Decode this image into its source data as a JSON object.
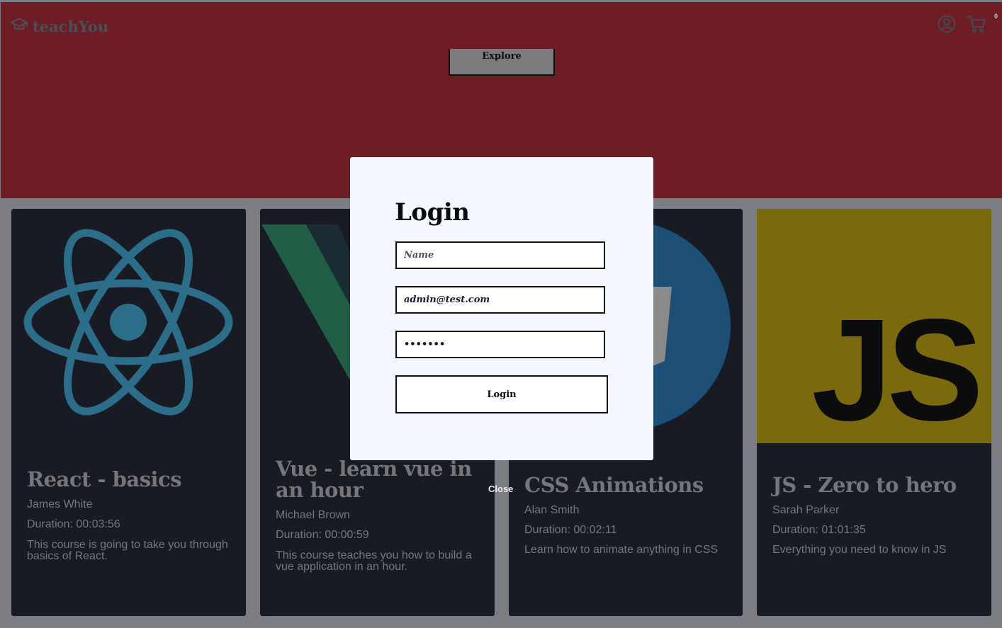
{
  "header": {
    "logo_text": "teachYou",
    "logo_icon": "graduation-cap-icon",
    "user_icon": "user-circle-icon",
    "cart_icon": "cart-icon",
    "cart_count": "0",
    "explore_label": "Explore",
    "hero_color": "#6e1d25"
  },
  "courses": [
    {
      "title": "React - basics",
      "author": "James White",
      "duration": "Duration: 00:03:56",
      "description": "This course is going to take you through basics of React.",
      "image_icon": "react-logo-icon"
    },
    {
      "title": "Vue - learn vue in an hour",
      "author": "Michael Brown",
      "duration": "Duration: 00:00:59",
      "description": "This course teaches you how to build a vue application in an hour.",
      "image_icon": "vue-logo-icon"
    },
    {
      "title": "CSS Animations",
      "author": "Alan Smith",
      "duration": "Duration: 00:02:11",
      "description": "Learn how to animate anything in CSS",
      "image_icon": "css-logo-icon"
    },
    {
      "title": "JS - Zero to hero",
      "author": "Sarah Parker",
      "duration": "Duration: 01:01:35",
      "description": "Everything you need to know in JS",
      "image_icon": "js-logo-icon"
    }
  ],
  "modal": {
    "title": "Login",
    "name_placeholder": "Name",
    "name_value": "",
    "email_value": "admin@test.com",
    "password_value": "•••••••",
    "login_label": "Login",
    "close_label": "Close"
  }
}
